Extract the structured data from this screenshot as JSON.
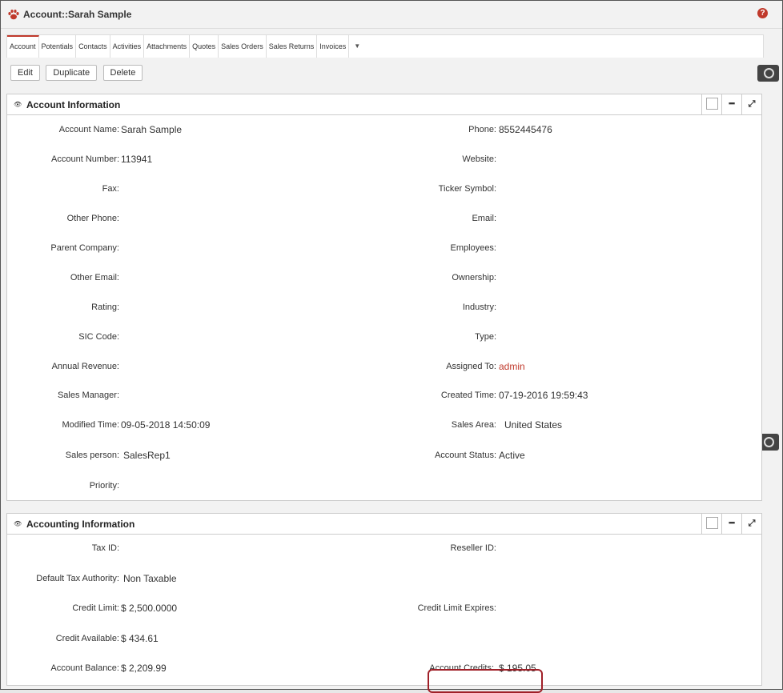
{
  "title": "Account::Sarah Sample",
  "help_glyph": "?",
  "tabs": [
    {
      "label": "Account",
      "active": true
    },
    {
      "label": "Potentials"
    },
    {
      "label": "Contacts"
    },
    {
      "label": "Activities"
    },
    {
      "label": "Attachments"
    },
    {
      "label": "Quotes"
    },
    {
      "label": "Sales Orders"
    },
    {
      "label": "Sales Returns"
    },
    {
      "label": "Invoices"
    }
  ],
  "toolbar": {
    "edit_label": "Edit",
    "duplicate_label": "Duplicate",
    "delete_label": "Delete"
  },
  "account_info": {
    "title": "Account Information",
    "left": [
      {
        "label": "Account Name:",
        "value": "Sarah Sample"
      },
      {
        "label": "Account Number:",
        "value": "113941"
      },
      {
        "label": "Fax:",
        "value": ""
      },
      {
        "label": "Other Phone:",
        "value": ""
      },
      {
        "label": "Parent Company:",
        "value": ""
      },
      {
        "label": "Other Email:",
        "value": ""
      },
      {
        "label": "Rating:",
        "value": ""
      },
      {
        "label": "SIC Code:",
        "value": ""
      },
      {
        "label": "Annual Revenue:",
        "value": ""
      },
      {
        "label": "Sales Manager:",
        "value": ""
      },
      {
        "label": "Modified Time:",
        "value": "09-05-2018 14:50:09"
      },
      {
        "label": "Sales person:",
        "value": "SalesRep1"
      },
      {
        "label": "Priority:",
        "value": ""
      }
    ],
    "right": [
      {
        "label": "Phone:",
        "value": "8552445476"
      },
      {
        "label": "Website:",
        "value": ""
      },
      {
        "label": "Ticker Symbol:",
        "value": ""
      },
      {
        "label": "Email:",
        "value": ""
      },
      {
        "label": "Employees:",
        "value": ""
      },
      {
        "label": "Ownership:",
        "value": ""
      },
      {
        "label": "Industry:",
        "value": ""
      },
      {
        "label": "Type:",
        "value": ""
      },
      {
        "label": "Assigned To:",
        "value": "admin"
      },
      {
        "label": "Created Time:",
        "value": "07-19-2016 19:59:43"
      },
      {
        "label": "Sales Area:",
        "value": "United States"
      },
      {
        "label": "Account Status:",
        "value": "Active"
      }
    ]
  },
  "accounting_info": {
    "title": "Accounting Information",
    "left": [
      {
        "label": "Tax ID:",
        "value": ""
      },
      {
        "label": "Default Tax Authority:",
        "value": "Non Taxable"
      },
      {
        "label": "Credit Limit:",
        "value": "$ 2,500.0000"
      },
      {
        "label": "Credit Available:",
        "value": "$ 434.61"
      },
      {
        "label": "Account Balance:",
        "value": "$ 2,209.99"
      }
    ],
    "right": [
      {
        "label": "Reseller ID:",
        "value": ""
      },
      {
        "label": "Credit Limit Expires:",
        "value": ""
      },
      {
        "label": "Account Credits:",
        "value": "$ 195.05"
      }
    ]
  },
  "colors": {
    "accent": "#c0392b",
    "highlight_border": "#a02028"
  }
}
